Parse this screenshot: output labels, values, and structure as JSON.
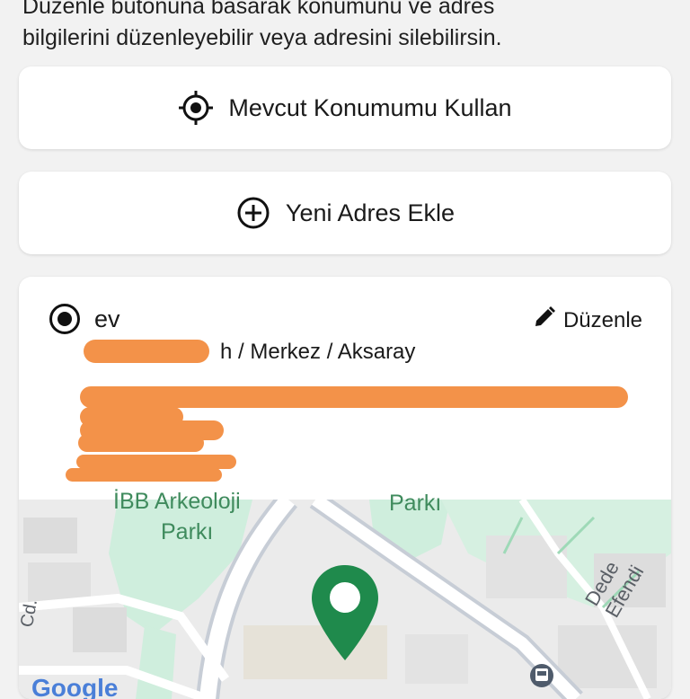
{
  "intro": {
    "line1": "Düzenle butonuna basarak konumunu ve adres",
    "line2": "bilgilerini düzenleyebilir veya adresini silebilirsin."
  },
  "actions": {
    "current_location_label": "Mevcut Konumumu Kullan",
    "current_location_icon": "crosshair-icon",
    "new_address_label": "Yeni Adres Ekle",
    "new_address_icon": "plus-circle-icon"
  },
  "address": {
    "title": "ev",
    "selected": true,
    "edit_label": "Düzenle",
    "edit_icon": "pencil-icon",
    "district_line": "h / Merkez / Aksaray"
  },
  "map": {
    "labels": [
      "İBB Arkeoloji",
      "Parkı",
      "Parkı",
      "Dede Efendi",
      "Cd."
    ],
    "brand": "Google",
    "pin_color": "#1f8a4c"
  }
}
